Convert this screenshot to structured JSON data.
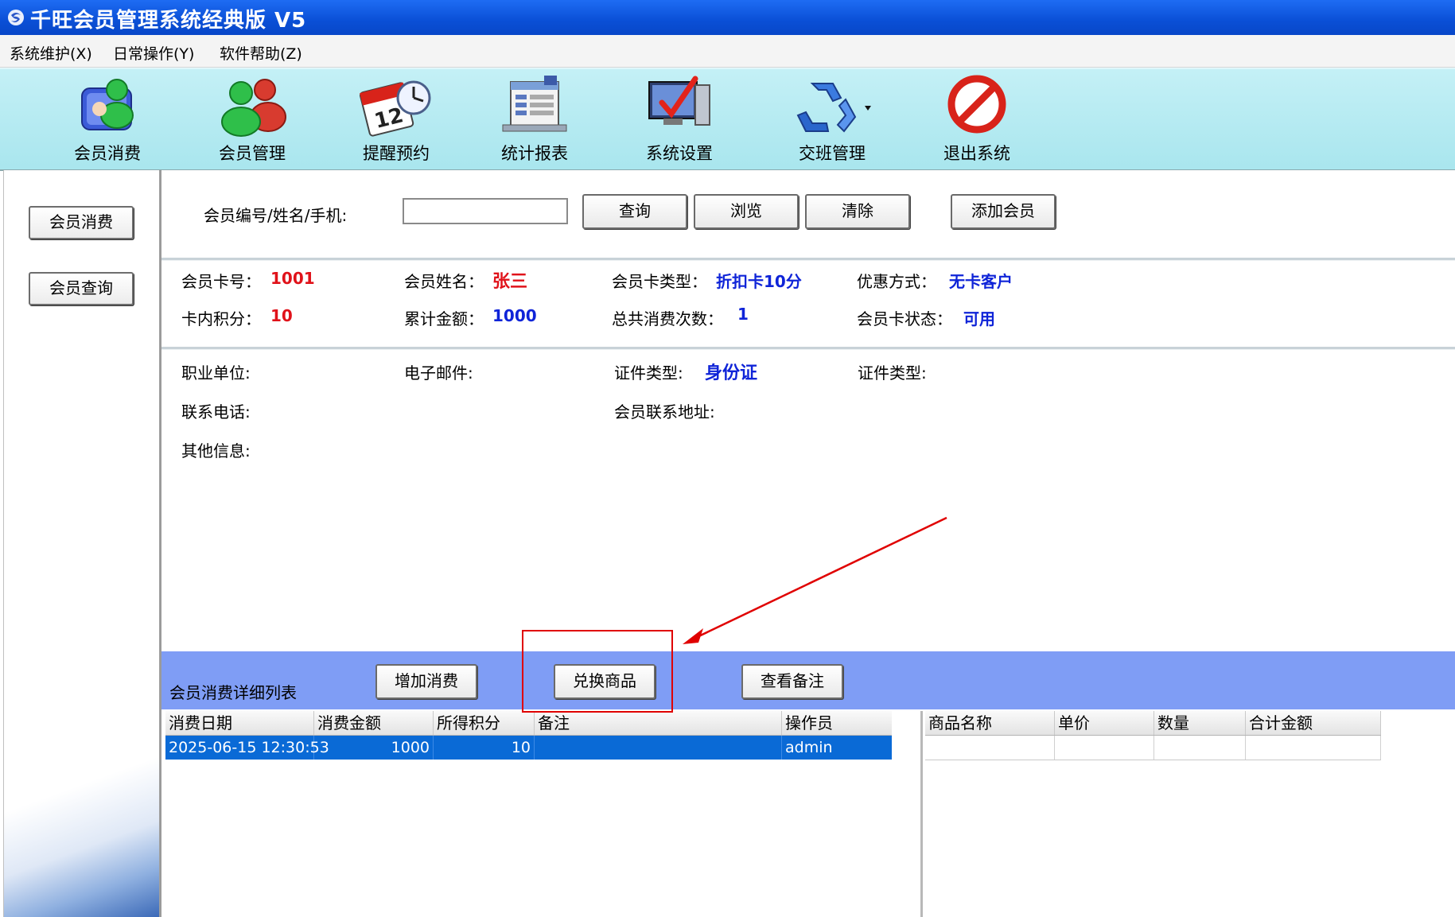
{
  "window": {
    "title": "千旺会员管理系统经典版 V5"
  },
  "menu": [
    {
      "label": "系统维护(X)"
    },
    {
      "label": "日常操作(Y)"
    },
    {
      "label": "软件帮助(Z)"
    }
  ],
  "toolbar": [
    {
      "label": "会员消费",
      "icon": "member-consume-icon"
    },
    {
      "label": "会员管理",
      "icon": "member-manage-icon"
    },
    {
      "label": "提醒预约",
      "icon": "calendar-clock-icon"
    },
    {
      "label": "统计报表",
      "icon": "report-icon"
    },
    {
      "label": "系统设置",
      "icon": "settings-monitor-icon"
    },
    {
      "label": "交班管理",
      "icon": "recycle-icon"
    },
    {
      "label": "退出系统",
      "icon": "exit-icon"
    }
  ],
  "sidebar": {
    "buttons": [
      {
        "label": "会员消费"
      },
      {
        "label": "会员查询"
      }
    ]
  },
  "search": {
    "label": "会员编号/姓名/手机:",
    "value": "",
    "buttons": {
      "query": "查询",
      "browse": "浏览",
      "clear": "清除",
      "add": "添加会员"
    }
  },
  "member": {
    "card_no_label": "会员卡号：",
    "card_no": "1001",
    "name_label": "会员姓名：",
    "name": "张三",
    "card_type_label": "会员卡类型：",
    "card_type": "折扣卡10分",
    "discount_label": "优惠方式：",
    "discount": "无卡客户",
    "points_label": "卡内积分：",
    "points": "10",
    "total_label": "累计金额：",
    "total": "1000",
    "count_label": "总共消费次数：",
    "count": "1",
    "status_label": "会员卡状态：",
    "status": "可用"
  },
  "extra": {
    "work_label": "职业单位:",
    "email_label": "电子邮件:",
    "id_type_label": "证件类型:",
    "id_type": "身份证",
    "id_type2_label": "证件类型:",
    "phone_label": "联系电话:",
    "address_label": "会员联系地址:",
    "other_label": "其他信息:"
  },
  "detail": {
    "title": "会员消费详细列表",
    "add_button": "增加消费",
    "exchange_button": "兑换商品",
    "note_button": "查看备注"
  },
  "consume_table": {
    "headers": [
      "消费日期",
      "消费金额",
      "所得积分",
      "备注",
      "操作员"
    ],
    "rows": [
      {
        "date": "2025-06-15 12:30:53",
        "amount": "1000",
        "points": "10",
        "note": "",
        "operator": "admin"
      }
    ]
  },
  "goods_table": {
    "headers": [
      "商品名称",
      "单价",
      "数量",
      "合计金额"
    ]
  },
  "colors": {
    "title_bar": "#0a4fd6",
    "toolbar_bg": "#b3eaf1",
    "detail_bar": "#7f9df5",
    "row_selected": "#0a6ad6",
    "value_red": "#e0121a",
    "value_blue": "#0f24d8",
    "annotation": "#e00000"
  }
}
